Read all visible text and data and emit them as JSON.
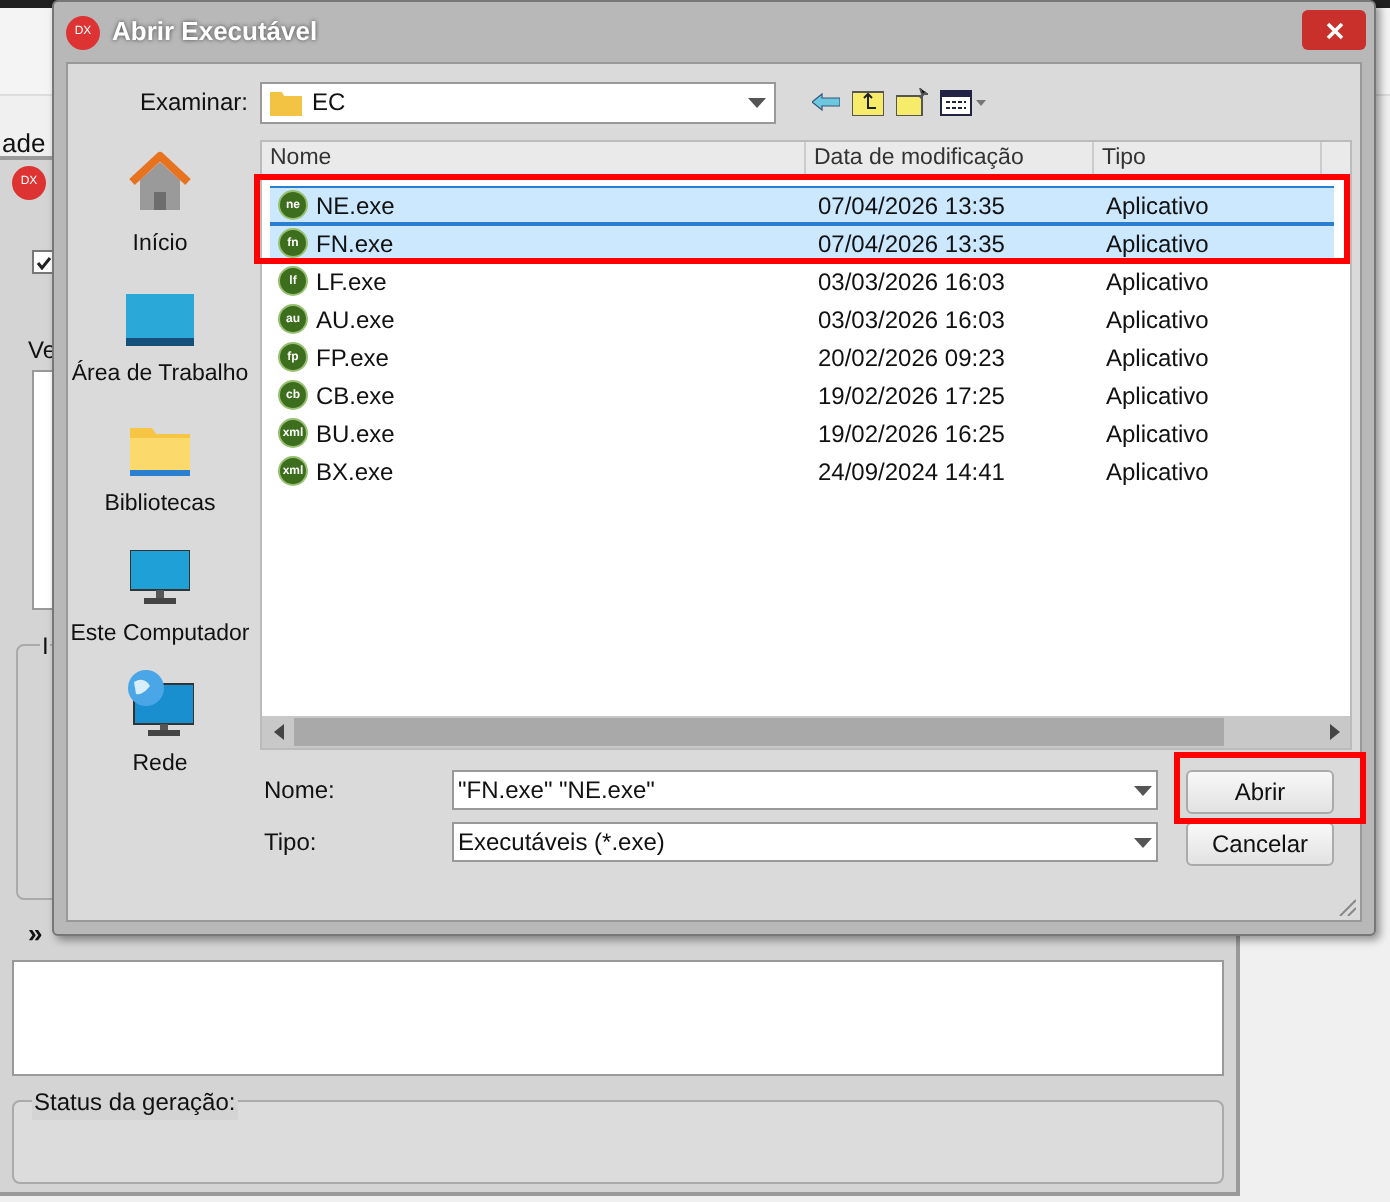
{
  "background_window": {
    "app_icon": "DX",
    "menu_fragment": "ade",
    "field_label_fragment": "Ve",
    "group_label_fragment": "I",
    "checkbox_checked": true,
    "expand_button": "»",
    "status_group": "Status da geração:"
  },
  "dialog": {
    "title": "Abrir Executável",
    "app_icon": "DX",
    "look_in_label": "Examinar:",
    "look_in_value": "EC",
    "places": [
      {
        "kind": "home",
        "label": "Início"
      },
      {
        "kind": "desktop",
        "label": "Área de Trabalho"
      },
      {
        "kind": "libraries",
        "label": "Bibliotecas"
      },
      {
        "kind": "computer",
        "label": "Este Computador"
      },
      {
        "kind": "network",
        "label": "Rede"
      }
    ],
    "columns": [
      "Nome",
      "Data de modificação",
      "Tipo"
    ],
    "files": [
      {
        "icon_text": "ne",
        "name": "NE.exe",
        "modified": "07/04/2026 13:35",
        "type": "Aplicativo",
        "selected": true
      },
      {
        "icon_text": "fn",
        "name": "FN.exe",
        "modified": "07/04/2026 13:35",
        "type": "Aplicativo",
        "selected": true
      },
      {
        "icon_text": "lf",
        "name": "LF.exe",
        "modified": "03/03/2026 16:03",
        "type": "Aplicativo",
        "selected": false
      },
      {
        "icon_text": "au",
        "name": "AU.exe",
        "modified": "03/03/2026 16:03",
        "type": "Aplicativo",
        "selected": false
      },
      {
        "icon_text": "fp",
        "name": "FP.exe",
        "modified": "20/02/2026 09:23",
        "type": "Aplicativo",
        "selected": false
      },
      {
        "icon_text": "cb",
        "name": "CB.exe",
        "modified": "19/02/2026 17:25",
        "type": "Aplicativo",
        "selected": false
      },
      {
        "icon_text": "xml",
        "name": "BU.exe",
        "modified": "19/02/2026 16:25",
        "type": "Aplicativo",
        "selected": false
      },
      {
        "icon_text": "xml",
        "name": "BX.exe",
        "modified": "24/09/2024 14:41",
        "type": "Aplicativo",
        "selected": false
      }
    ],
    "file_name_label": "Nome:",
    "file_name_value": "\"FN.exe\" \"NE.exe\"",
    "file_type_label": "Tipo:",
    "file_type_value": "Executáveis (*.exe)",
    "open_button": "Abrir",
    "cancel_button": "Cancelar"
  }
}
